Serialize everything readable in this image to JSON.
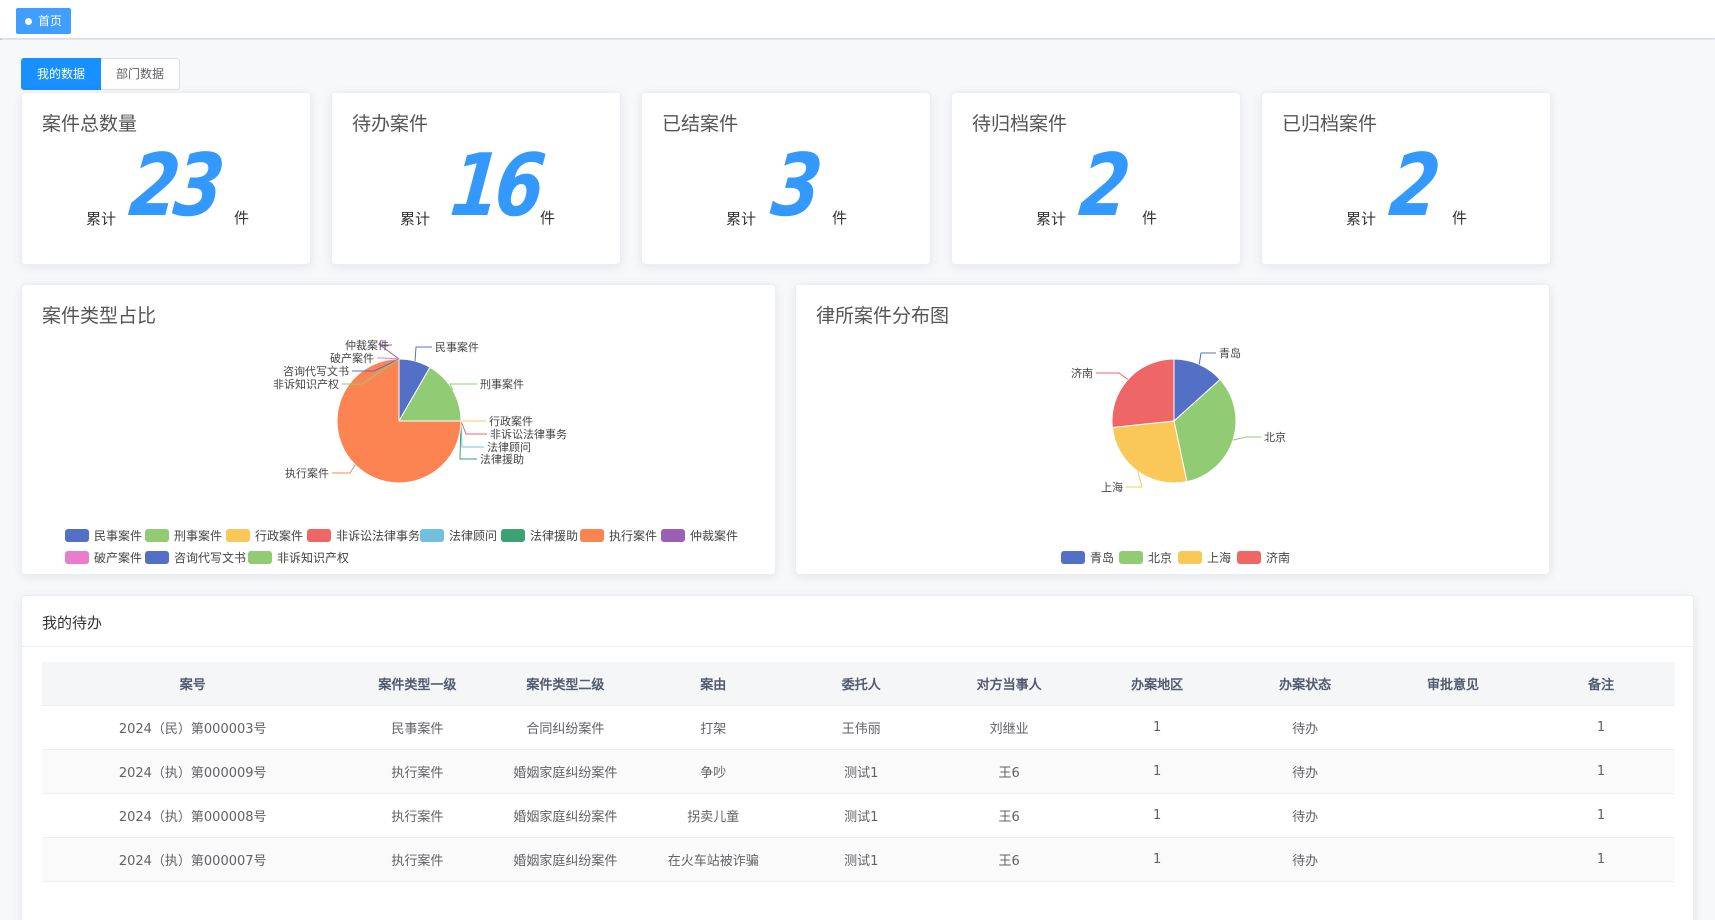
{
  "tab": {
    "label": "首页"
  },
  "scope_tabs": [
    "我的数据",
    "部门数据"
  ],
  "stats": [
    {
      "title": "案件总数量",
      "prefix": "累计",
      "value": "23",
      "suffix": "件"
    },
    {
      "title": "待办案件",
      "prefix": "累计",
      "value": "16",
      "suffix": "件"
    },
    {
      "title": "已结案件",
      "prefix": "累计",
      "value": "3",
      "suffix": "件"
    },
    {
      "title": "待归档案件",
      "prefix": "累计",
      "value": "2",
      "suffix": "件"
    },
    {
      "title": "已归档案件",
      "prefix": "累计",
      "value": "2",
      "suffix": "件"
    }
  ],
  "pie1": {
    "title": "案件类型占比",
    "slices": [
      {
        "label": "民事案件",
        "value": 1,
        "color": "#5470c6"
      },
      {
        "label": "刑事案件",
        "value": 2,
        "color": "#91cc75"
      },
      {
        "label": "行政案件",
        "value": 0,
        "color": "#fac858"
      },
      {
        "label": "非诉讼法律事务",
        "value": 0,
        "color": "#ee6666"
      },
      {
        "label": "法律顾问",
        "value": 0,
        "color": "#73c0de"
      },
      {
        "label": "法律援助",
        "value": 0,
        "color": "#3ba272"
      },
      {
        "label": "执行案件",
        "value": 9,
        "color": "#fc8452"
      },
      {
        "label": "仲裁案件",
        "value": 0,
        "color": "#9a60b4"
      },
      {
        "label": "破产案件",
        "value": 0,
        "color": "#ea7ccc"
      },
      {
        "label": "咨询代写文书",
        "value": 0,
        "color": "#5470c6"
      },
      {
        "label": "非诉知识产权",
        "value": 0,
        "color": "#91cc75"
      }
    ]
  },
  "pie2": {
    "title": "律所案件分布图",
    "slices": [
      {
        "label": "青岛",
        "value": 2,
        "color": "#5470c6"
      },
      {
        "label": "北京",
        "value": 5,
        "color": "#91cc75"
      },
      {
        "label": "上海",
        "value": 4,
        "color": "#fac858"
      },
      {
        "label": "济南",
        "value": 4,
        "color": "#ee6666"
      }
    ]
  },
  "todo": {
    "title": "我的待办",
    "columns": [
      "案号",
      "案件类型一级",
      "案件类型二级",
      "案由",
      "委托人",
      "对方当事人",
      "办案地区",
      "办案状态",
      "审批意见",
      "备注"
    ],
    "rows": [
      [
        "2024（民）第000003号",
        "民事案件",
        "合同纠纷案件",
        "打架",
        "王伟丽",
        "刘继业",
        "1",
        "待办",
        "",
        "1"
      ],
      [
        "2024（执）第000009号",
        "执行案件",
        "婚姻家庭纠纷案件",
        "争吵",
        "测试1",
        "王6",
        "1",
        "待办",
        "",
        "1"
      ],
      [
        "2024（执）第000008号",
        "执行案件",
        "婚姻家庭纠纷案件",
        "拐卖儿童",
        "测试1",
        "王6",
        "1",
        "待办",
        "",
        "1"
      ],
      [
        "2024（执）第000007号",
        "执行案件",
        "婚姻家庭纠纷案件",
        "在火车站被诈骗",
        "测试1",
        "王6",
        "1",
        "待办",
        "",
        "1"
      ]
    ]
  }
}
